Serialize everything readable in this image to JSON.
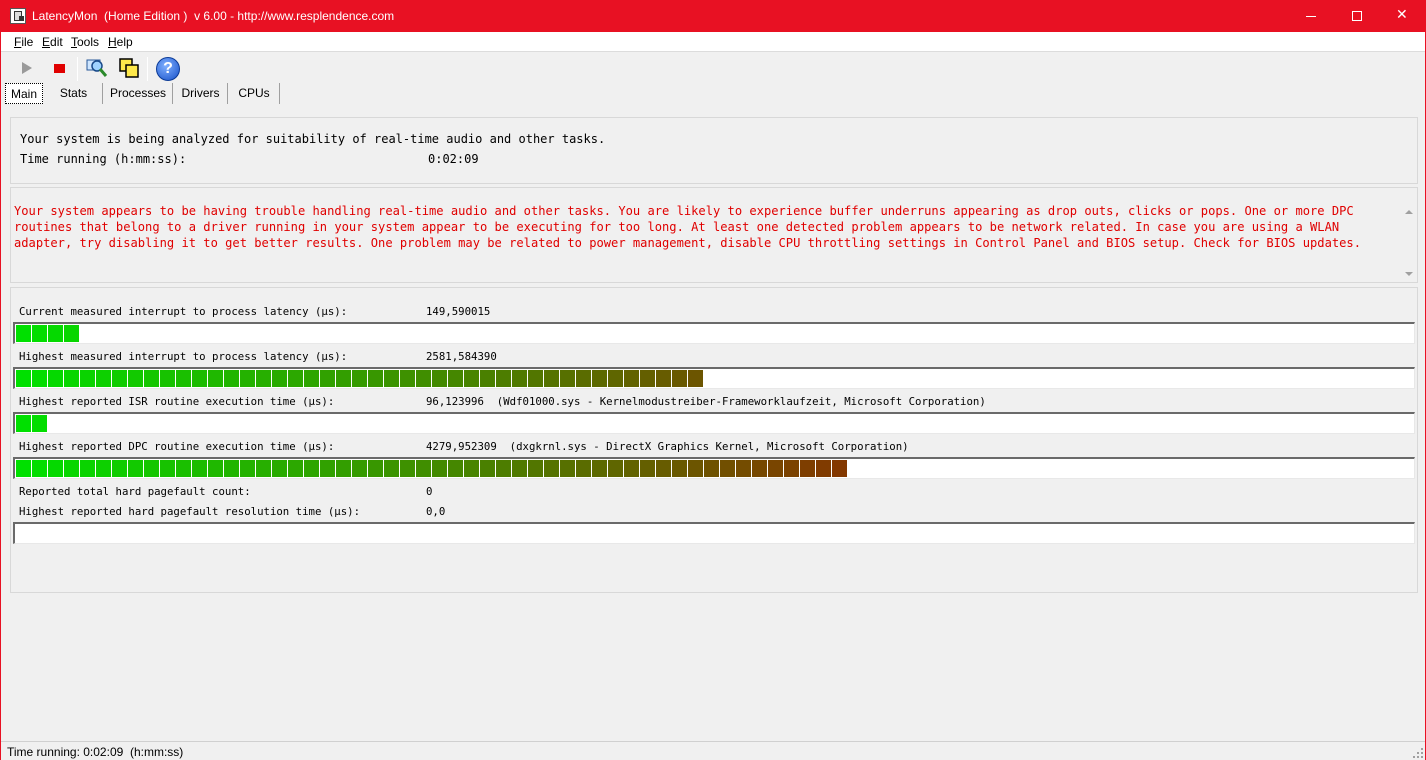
{
  "window": {
    "title": "LatencyMon  (Home Edition )  v 6.00 - http://www.resplendence.com",
    "title_bar_color": "#e81123",
    "close_glyph": "✕"
  },
  "menu": [
    {
      "first": "F",
      "rest": "ile"
    },
    {
      "first": "E",
      "rest": "dit"
    },
    {
      "first": "T",
      "rest": "ools"
    },
    {
      "first": "H",
      "rest": "elp"
    }
  ],
  "toolbar": {
    "buttons": [
      "play-icon",
      "stop-icon",
      "magnify-icon",
      "windows-icon",
      "help-icon"
    ],
    "help_glyph": "?"
  },
  "tabs": [
    {
      "label": "Main",
      "active": true
    },
    {
      "label": "Stats",
      "active": false
    },
    {
      "label": "Processes",
      "active": false
    },
    {
      "label": "Drivers",
      "active": false
    },
    {
      "label": "CPUs",
      "active": false
    }
  ],
  "status": {
    "line1": "Your system is being analyzed for suitability of real-time audio and other tasks.",
    "time_label": "Time running (h:mm:ss):",
    "time_value": "0:02:09"
  },
  "warning": {
    "text": "Your system appears to be having trouble handling real-time audio and other tasks. You are likely to experience buffer underruns appearing as drop outs, clicks or pops. One or more DPC routines that belong to a driver running in your system appear to be executing for too long. At least one detected problem appears to be network related. In case you are using a WLAN adapter, try disabling it to get better results. One problem may be related to power management, disable CPU throttling settings in Control Panel and BIOS setup. Check for BIOS updates.",
    "color": "#e00000"
  },
  "metrics": [
    {
      "label": "Current measured interrupt to process latency (µs):",
      "value": "149,590015",
      "segments": 4
    },
    {
      "label": "Highest measured interrupt to process latency (µs):",
      "value": "2581,584390",
      "segments": 43
    },
    {
      "label": "Highest reported ISR routine execution time (µs):",
      "value": "96,123996  (Wdf01000.sys - Kernelmodustreiber-Frameworklaufzeit, Microsoft Corporation)",
      "segments": 2
    },
    {
      "label": "Highest reported DPC routine execution time (µs):",
      "value": "4279,952309  (dxgkrnl.sys - DirectX Graphics Kernel, Microsoft Corporation)",
      "segments": 52
    },
    {
      "label": "Reported total hard pagefault count:",
      "value": "0"
    },
    {
      "label": "Highest reported hard pagefault resolution time (µs):",
      "value": "0,0",
      "segments": 0
    }
  ],
  "meter_colors": {
    "start": "#00e000",
    "end": "#9a1a00"
  },
  "statusbar": {
    "text": "Time running: 0:02:09  (h:mm:ss)"
  }
}
